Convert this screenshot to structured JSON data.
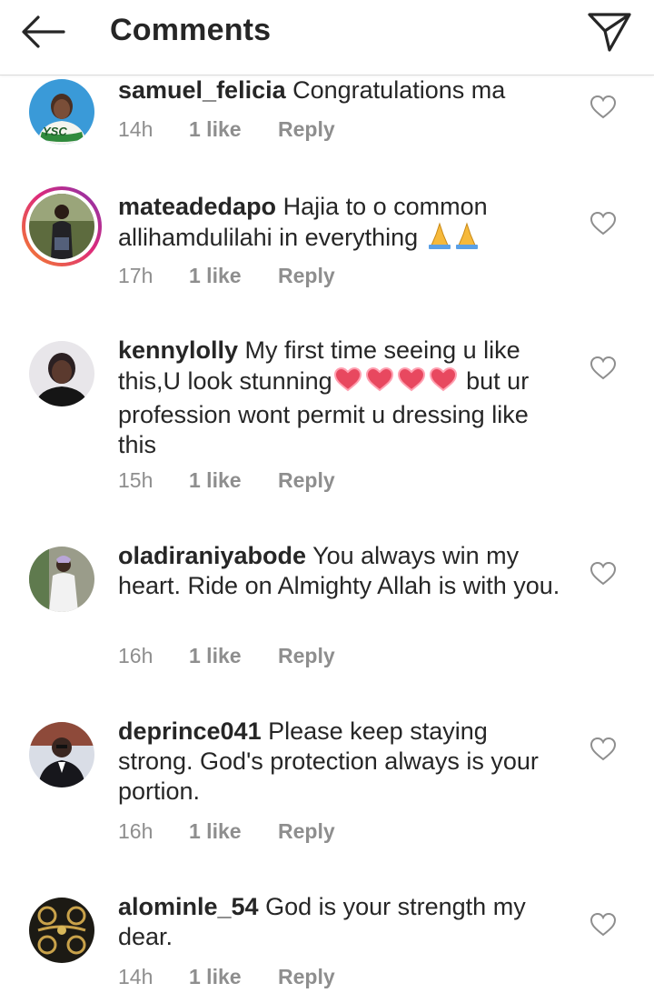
{
  "header": {
    "title": "Comments"
  },
  "comments": [
    {
      "username": "samuel_felicia",
      "text": " Congratulations ma",
      "time": "14h",
      "likes": "1 like",
      "reply": "Reply",
      "avatar_label": "YSC"
    },
    {
      "username": "mateadedapo",
      "text": " Hajia to o common allihamdulilahi in everything ",
      "time": "17h",
      "likes": "1 like",
      "reply": "Reply"
    },
    {
      "username": "kennylolly",
      "text_a": " My first time seeing u like this,U look stunning",
      "text_b": " but ur profession wont permit u dressing like this",
      "time": "15h",
      "likes": "1 like",
      "reply": "Reply"
    },
    {
      "username": "oladiraniyabode",
      "text": " You always win my heart. Ride on Almighty Allah is with you.",
      "time": "16h",
      "likes": "1 like",
      "reply": "Reply"
    },
    {
      "username": "deprince041",
      "text": " Please keep staying strong. God's protection always is your portion.",
      "time": "16h",
      "likes": "1 like",
      "reply": "Reply"
    },
    {
      "username": "alominle_54",
      "text": " God is your strength my dear.",
      "time": "14h",
      "likes": "1 like",
      "reply": "Reply"
    }
  ],
  "icons": {
    "back": "arrow-left-icon",
    "send": "paper-plane-icon",
    "like": "heart-outline-icon",
    "pray": "folded-hands-emoji",
    "heart": "sparkling-heart-emoji"
  },
  "colors": {
    "text": "#262626",
    "meta": "#8e8e8e",
    "icon": "#262626",
    "heart_outline": "#8e8e8e",
    "story_ring_start": "#f58529",
    "story_ring_end": "#8134af",
    "emoji_heart": "#e8485f",
    "emoji_pray": "#f6b93b"
  }
}
